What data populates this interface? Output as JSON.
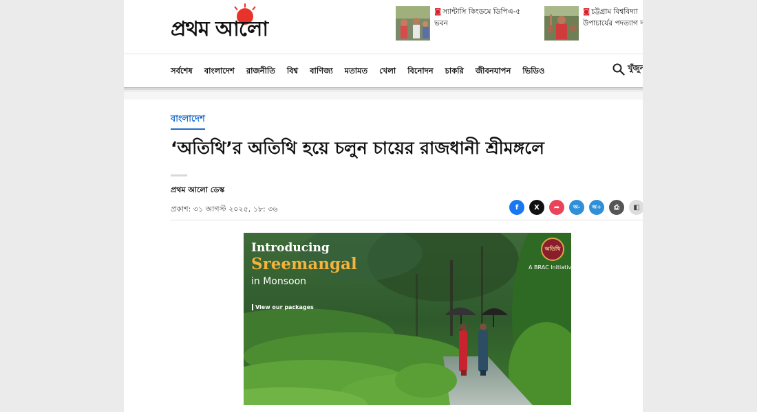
{
  "logo": {
    "text": "প্রথম আলো"
  },
  "teasers": [
    {
      "text": "স্যান্টাসি কিংডমে ডিপিএ-৫",
      "text2": "ভবন"
    },
    {
      "text": "চট্টগ্রাম বিশ্ববিদ্যা",
      "text2": "উপাচার্যের পদত্যাগ দা"
    }
  ],
  "nav": {
    "items": [
      "সর্বশেষ",
      "বাংলাদেশ",
      "রাজনীতি",
      "বিশ্ব",
      "বাণিজ্য",
      "মতামত",
      "খেলা",
      "বিনোদন",
      "চাকরি",
      "জীবনযাপন",
      "ভিডিও"
    ],
    "search_label": "খুঁজুন"
  },
  "article": {
    "section": "বাংলাদেশ",
    "headline": "‘অতিথি’র অতিথি হয়ে চলুন চায়ের রাজধানী শ্রীমঙ্গলে",
    "author": "প্রথম আলো ডেস্ক",
    "published": "প্রকাশ: ৩১ আগস্ট ২০২৫, ১৮: ৩৬"
  },
  "share": {
    "buttons": [
      {
        "icon": "facebook-icon",
        "glyph": "f",
        "color": "#1877f2"
      },
      {
        "icon": "x-icon",
        "glyph": "X",
        "color": "#111111"
      },
      {
        "icon": "share-icon",
        "glyph": "➦",
        "color": "#e9455a"
      },
      {
        "icon": "font-decrease-icon",
        "glyph": "অ-",
        "color": "#2f8fd8"
      },
      {
        "icon": "font-increase-icon",
        "glyph": "অ+",
        "color": "#2f8fd8"
      },
      {
        "icon": "print-icon",
        "glyph": "⎙",
        "color": "#555555"
      },
      {
        "icon": "bookmark-icon",
        "glyph": "◧",
        "color": "#dddddd"
      }
    ]
  },
  "hero": {
    "intro": "Introducing",
    "title": "Sreemangal",
    "subtitle": "in Monsoon",
    "cta": "View our packages",
    "badge": "অতিথি",
    "badge_sub": "A BRAC Initiative"
  },
  "colors": {
    "accent": "#1a6cc9",
    "logo_sun": "#e8332a",
    "hero_title": "#f4b33e"
  }
}
